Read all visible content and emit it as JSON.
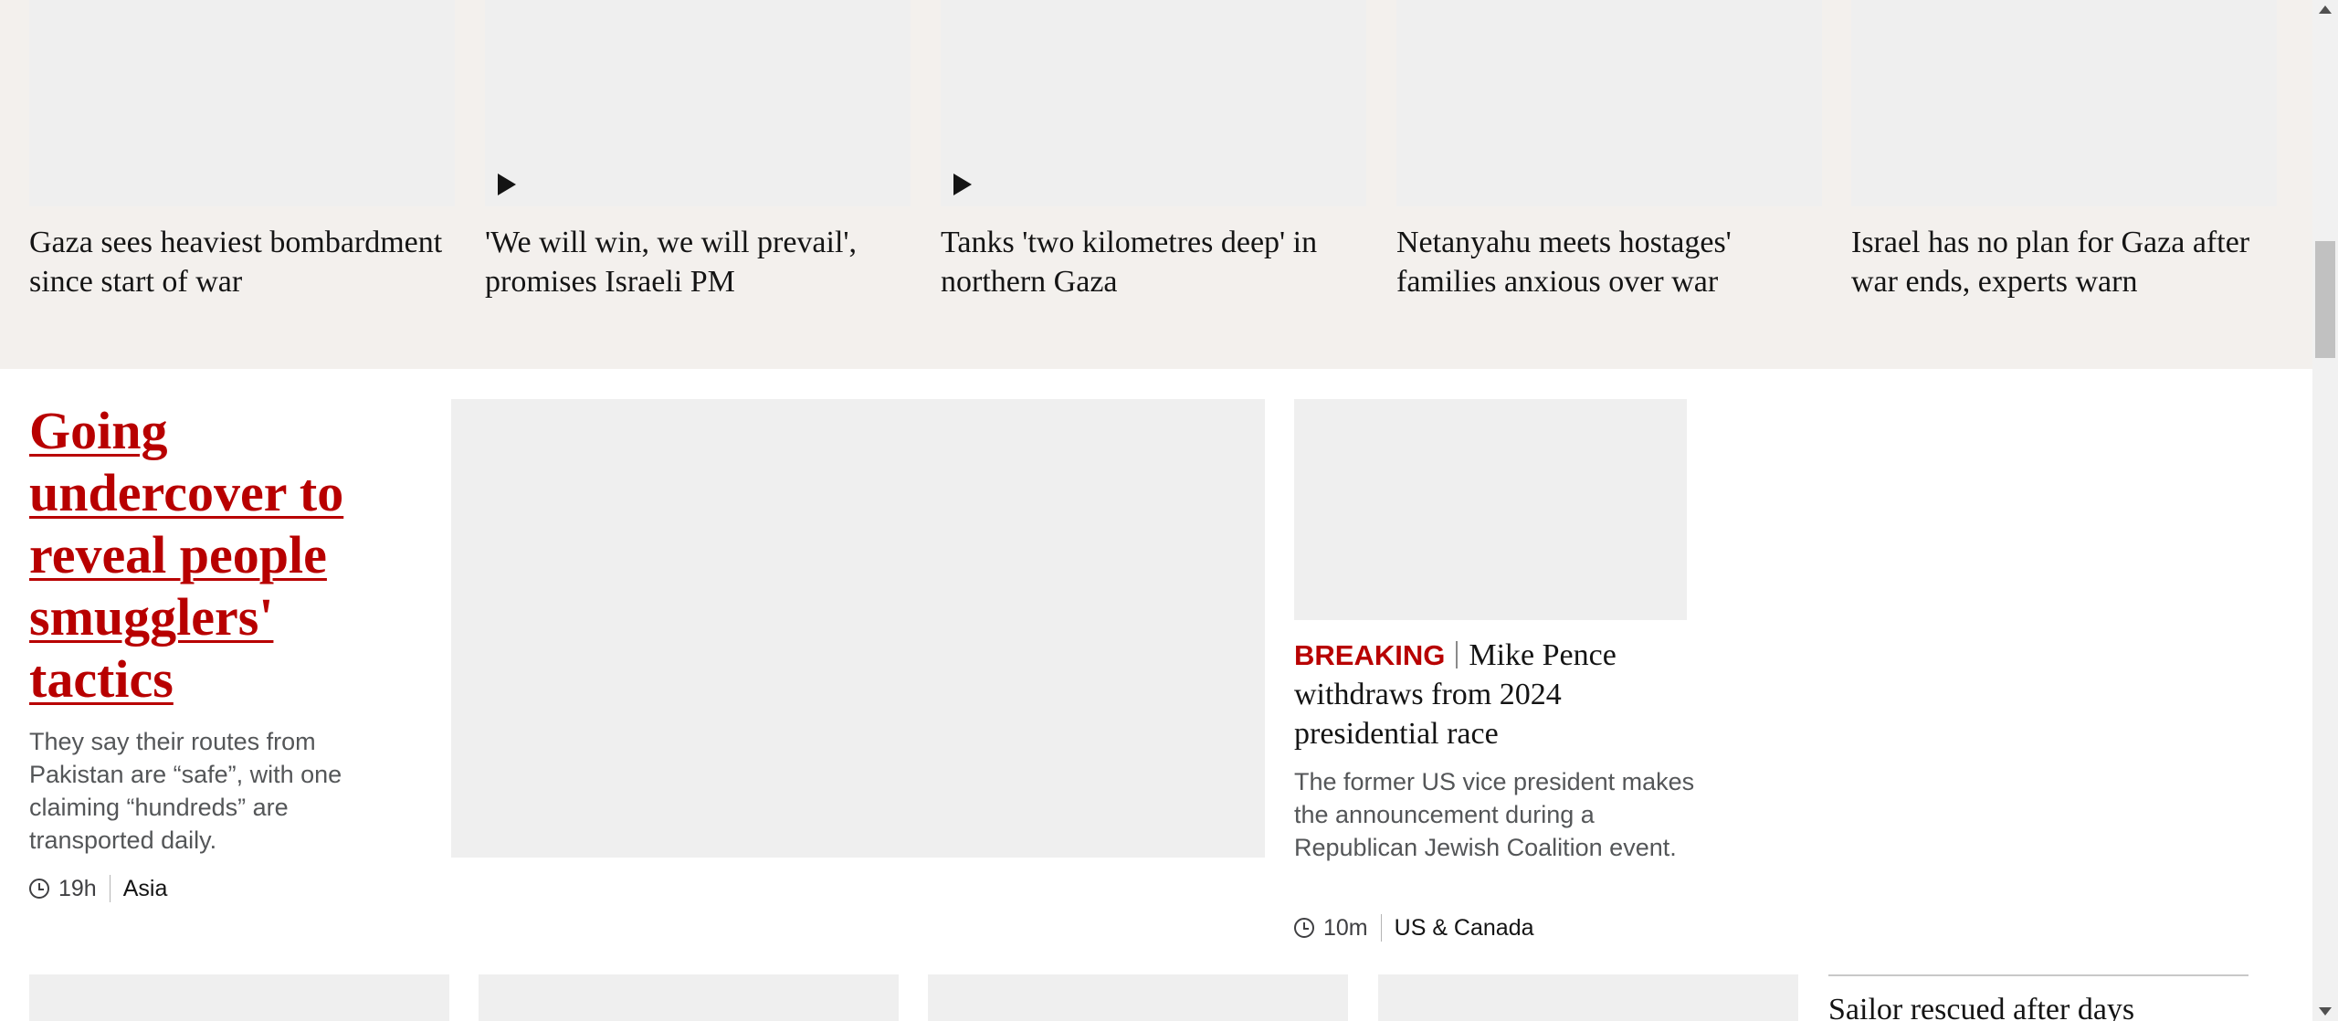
{
  "top_stories": [
    {
      "title": "Gaza sees heaviest bombardment since start of war",
      "has_video": false
    },
    {
      "title": "'We will win, we will prevail', promises Israeli PM",
      "has_video": true
    },
    {
      "title": "Tanks 'two kilometres deep' in northern Gaza",
      "has_video": true
    },
    {
      "title": "Netanyahu meets hostages' families anxious over war",
      "has_video": false
    },
    {
      "title": "Israel has no plan for Gaza after war ends, experts warn",
      "has_video": false
    }
  ],
  "feature": {
    "title": "Going undercover to reveal people smugglers' tactics",
    "summary": "They say their routes from Pakistan are “safe”, with one claiming “hundreds” are transported daily.",
    "time": "19h",
    "topic": "Asia"
  },
  "breaking": {
    "label": "BREAKING",
    "title": "Mike Pence withdraws from 2024 presidential race",
    "summary": "The former US vice president makes the announcement during a Republican Jewish Coalition event.",
    "time": "10m",
    "topic": "US & Canada"
  },
  "bottom": {
    "side_title": "Sailor rescued after days"
  },
  "colors": {
    "breaking_red": "#b80000",
    "band_background": "#f3f0ed",
    "image_placeholder": "#efefef"
  },
  "icons": {
    "play": "play-icon",
    "clock": "clock-icon"
  }
}
